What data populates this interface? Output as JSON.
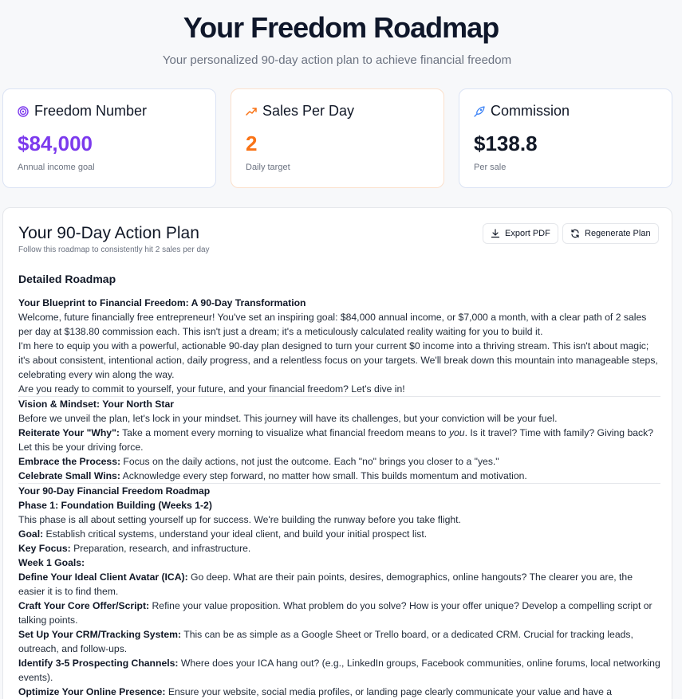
{
  "hero": {
    "title": "Your Freedom Roadmap",
    "subtitle": "Your personalized 90-day action plan to achieve financial freedom"
  },
  "stats": [
    {
      "label": "Freedom Number",
      "value": "$84,000",
      "caption": "Annual income goal",
      "icon": "target-icon",
      "color": "#7c3aed"
    },
    {
      "label": "Sales Per Day",
      "value": "2",
      "caption": "Daily target",
      "icon": "trending-up-icon",
      "color": "#f97316"
    },
    {
      "label": "Commission",
      "value": "$138.8",
      "caption": "Per sale",
      "icon": "rocket-icon",
      "color": "#111827"
    }
  ],
  "plan": {
    "title": "Your 90-Day Action Plan",
    "subtitle": "Follow this roadmap to consistently hit 2 sales per day",
    "export_label": "Export PDF",
    "regenerate_label": "Regenerate Plan",
    "section_title": "Detailed Roadmap",
    "blueprint": {
      "title": "Your Blueprint to Financial Freedom: A 90-Day Transformation",
      "p1": "Welcome, future financially free entrepreneur! You've set an inspiring goal: $84,000 annual income, or $7,000 a month, with a clear path of 2 sales per day at $138.80 commission each. This isn't just a dream; it's a meticulously calculated reality waiting for you to build it.",
      "p2": "I'm here to equip you with a powerful, actionable 90-day plan designed to turn your current $0 income into a thriving stream. This isn't about magic; it's about consistent, intentional action, daily progress, and a relentless focus on your targets. We'll break down this mountain into manageable steps, celebrating every win along the way.",
      "p3": "Are you ready to commit to yourself, your future, and your financial freedom? Let's dive in!"
    },
    "vision": {
      "title": "Vision & Mindset: Your North Star",
      "intro": "Before we unveil the plan, let's lock in your mindset. This journey will have its challenges, but your conviction will be your fuel.",
      "why_label": "Reiterate Your \"Why\":",
      "why_text_a": "Take a moment every morning to visualize what financial freedom means to",
      "why_em": "you",
      "why_text_b": ". Is it travel? Time with family? Giving back? Let this be your driving force.",
      "process_label": "Embrace the Process:",
      "process_text": "Focus on the daily actions, not just the outcome. Each \"no\" brings you closer to a \"yes.\"",
      "wins_label": "Celebrate Small Wins:",
      "wins_text": "Acknowledge every step forward, no matter how small. This builds momentum and motivation."
    },
    "roadmap": {
      "title": "Your 90-Day Financial Freedom Roadmap",
      "phase1": "Phase 1: Foundation Building (Weeks 1-2)",
      "phase1_intro": "This phase is all about setting yourself up for success. We're building the runway before you take flight.",
      "goal_label": "Goal:",
      "goal_text": "Establish critical systems, understand your ideal client, and build your initial prospect list.",
      "focus_label": "Key Focus:",
      "focus_text": "Preparation, research, and infrastructure.",
      "week1": "Week 1 Goals:",
      "ica_label": "Define Your Ideal Client Avatar (ICA):",
      "ica_text": "Go deep. What are their pain points, desires, demographics, online hangouts? The clearer you are, the easier it is to find them.",
      "offer_label": "Craft Your Core Offer/Script:",
      "offer_text": "Refine your value proposition. What problem do you solve? How is your offer unique? Develop a compelling script or talking points.",
      "crm_label": "Set Up Your CRM/Tracking System:",
      "crm_text": "This can be as simple as a Google Sheet or Trello board, or a dedicated CRM. Crucial for tracking leads, outreach, and follow-ups.",
      "channels_label": "Identify 3-5 Prospecting Channels:",
      "channels_text": "Where does your ICA hang out? (e.g., LinkedIn groups, Facebook communities, online forums, local networking events).",
      "presence_label": "Optimize Your Online Presence:",
      "presence_text": "Ensure your website, social media profiles, or landing page clearly communicate your value and have a"
    }
  }
}
